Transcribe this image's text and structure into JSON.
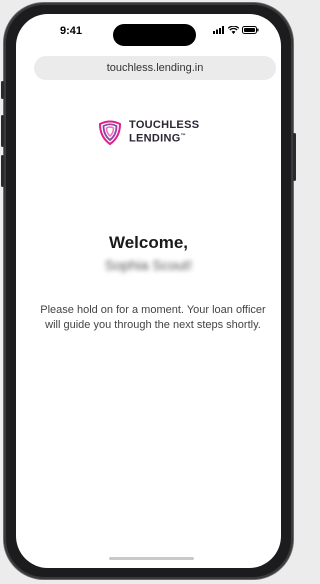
{
  "status_bar": {
    "time": "9:41",
    "icons": [
      "signal-icon",
      "wifi-icon",
      "battery-icon"
    ]
  },
  "browser": {
    "url": "touchless.lending.in"
  },
  "logo": {
    "line1": "TOUCHLESS",
    "line2": "LENDING",
    "trademark": "™",
    "colors": [
      "#e0218a",
      "#8e44ad",
      "#f06fb3"
    ]
  },
  "content": {
    "welcome": "Welcome,",
    "user_name": "Sophia Scout!",
    "message": "Please hold on for a moment. Your loan officer will guide you through the next steps shortly."
  }
}
